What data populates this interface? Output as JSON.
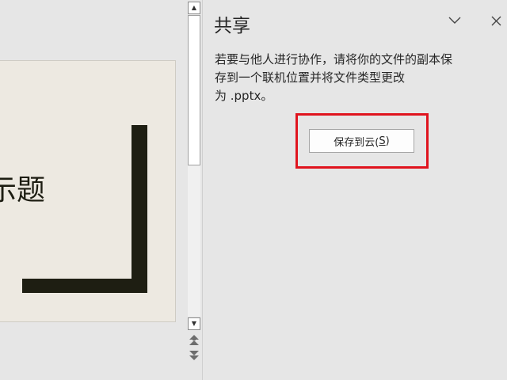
{
  "slide": {
    "title_fragment": "示题"
  },
  "scrollbar": {
    "up_glyph": "▲",
    "down_glyph": "▼",
    "prev_page_glyph": "⏶",
    "next_page_glyph": "⏷"
  },
  "share_pane": {
    "title": "共享",
    "dropdown_icon": "chevron-down-icon",
    "close_icon": "close-icon",
    "description_lines": [
      "若要与他人进行协作，请将你的文件的副本保",
      "存到一个联机位置并将文件类型更改",
      "为 .pptx。"
    ],
    "save_button_label_prefix": "保存到云(",
    "save_button_accesskey": "S",
    "save_button_label_suffix": ")",
    "highlight_color": "#e0141e"
  }
}
